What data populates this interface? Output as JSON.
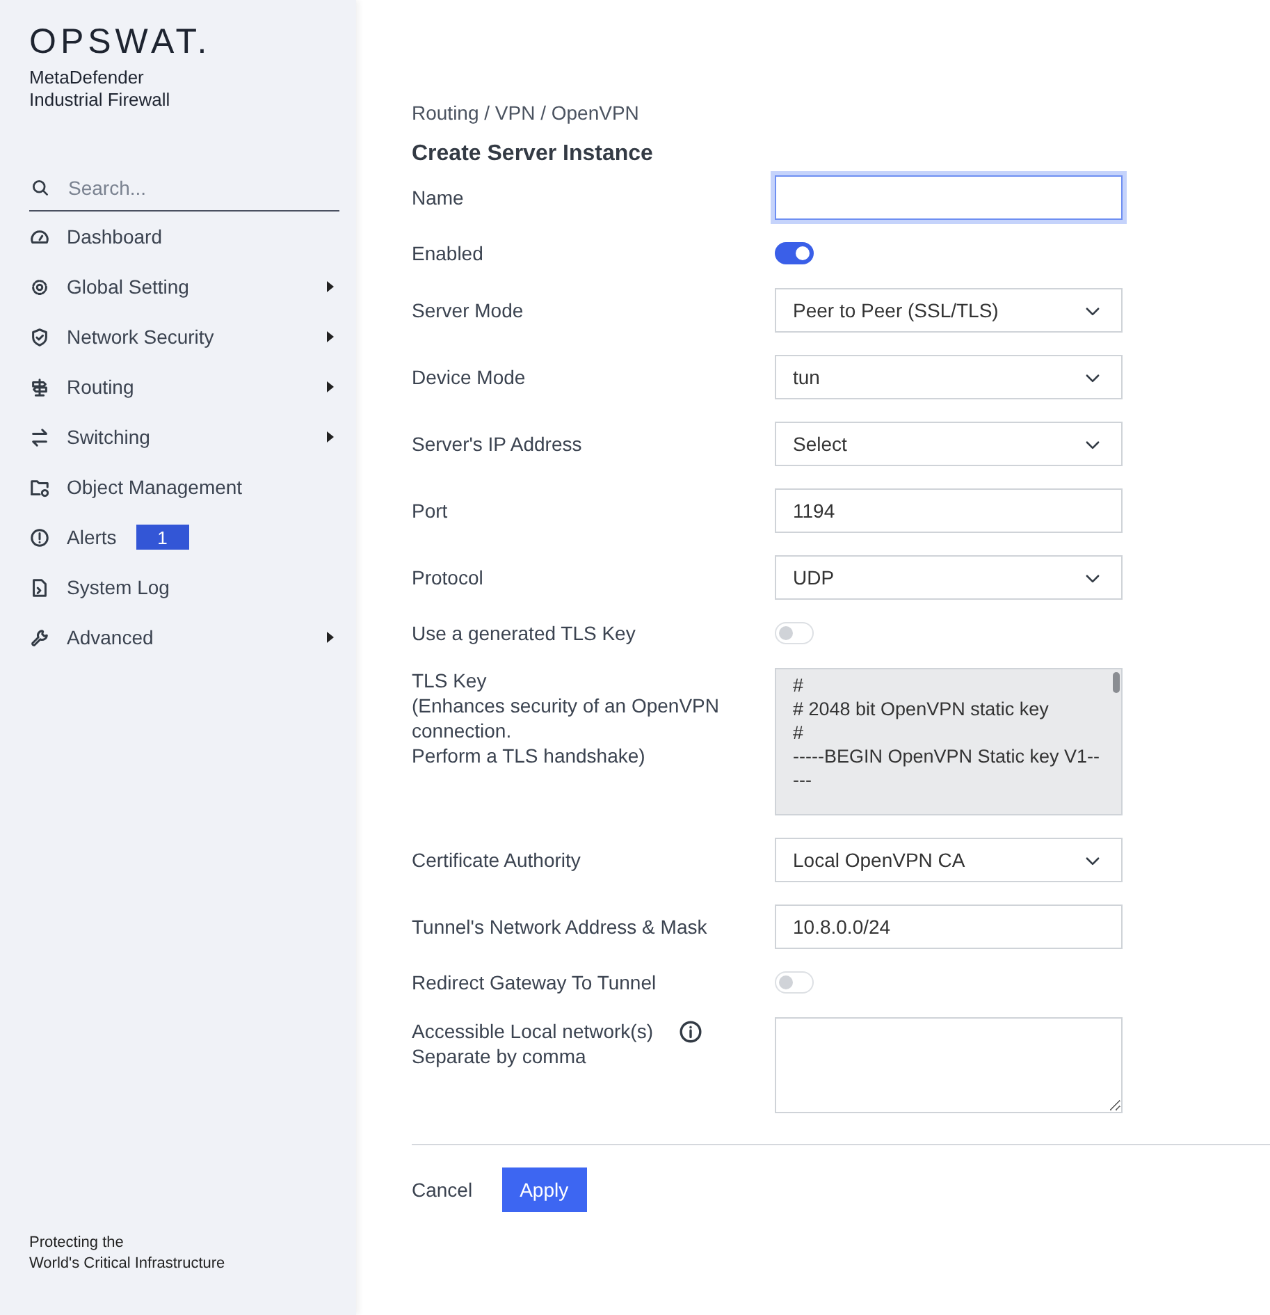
{
  "sidebar": {
    "logo": "OPSWAT.",
    "product": [
      "MetaDefender",
      "Industrial Firewall"
    ],
    "search": {
      "placeholder": "Search..."
    },
    "items": [
      {
        "label": "Dashboard",
        "submenu": false
      },
      {
        "label": "Global Setting",
        "submenu": true
      },
      {
        "label": "Network Security",
        "submenu": true
      },
      {
        "label": "Routing",
        "submenu": true
      },
      {
        "label": "Switching",
        "submenu": true
      },
      {
        "label": "Object Management",
        "submenu": false
      },
      {
        "label": "Alerts",
        "submenu": false,
        "badge": "1"
      },
      {
        "label": "System Log",
        "submenu": false
      },
      {
        "label": "Advanced",
        "submenu": true
      }
    ],
    "footer": [
      "Protecting the",
      "World's Critical Infrastructure"
    ]
  },
  "breadcrumb": "Routing / VPN / OpenVPN",
  "title": "Create Server Instance",
  "fields": [
    {
      "kind": "text",
      "label": "Name",
      "focused": true
    },
    {
      "kind": "toggle",
      "label": "Enabled",
      "on": true
    },
    {
      "kind": "select",
      "label": "Server Mode",
      "value": "Peer to Peer (SSL/TLS)"
    },
    {
      "kind": "select",
      "label": "Device Mode",
      "value": "tun"
    },
    {
      "kind": "select",
      "label": "Server's IP Address",
      "value": "Select"
    },
    {
      "kind": "text",
      "label": "Port",
      "value": "1194",
      "focused": false
    },
    {
      "kind": "select",
      "label": "Protocol",
      "value": "UDP"
    },
    {
      "kind": "toggle",
      "label": "Use a generated TLS Key",
      "on": false
    },
    {
      "kind": "keybox",
      "label": "TLS Key",
      "hint": [
        "(Enhances security of an OpenVPN connection.",
        "Perform a TLS handshake)"
      ],
      "lines": [
        "#",
        "# 2048 bit OpenVPN static key",
        "#",
        "-----BEGIN OpenVPN Static key V1--",
        "---"
      ]
    },
    {
      "kind": "select",
      "label": "Certificate Authority",
      "value": "Local OpenVPN CA"
    },
    {
      "kind": "text",
      "label": "Tunnel's Network Address & Mask",
      "value": "10.8.0.0/24",
      "focused": false
    },
    {
      "kind": "toggle",
      "label": "Redirect Gateway To Tunnel",
      "on": false
    },
    {
      "kind": "textarea",
      "label": "Accessible Local network(s)",
      "info": true,
      "hint": [
        "Separate by comma"
      ]
    }
  ],
  "buttons": [
    {
      "kind": "link",
      "label": "Cancel"
    },
    {
      "kind": "primary",
      "label": "Apply"
    }
  ]
}
